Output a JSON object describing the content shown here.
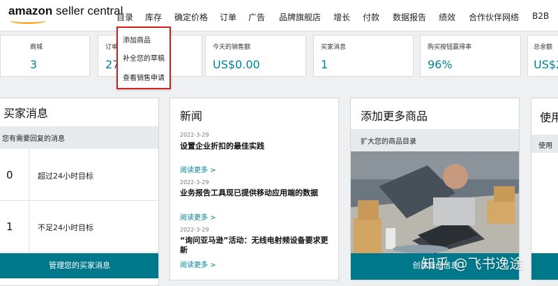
{
  "header": {
    "logo_brand": "amazon",
    "logo_product": " seller central",
    "nav": [
      "目录",
      "库存",
      "确定价格",
      "订单",
      "广告",
      "品牌旗舰店",
      "增长",
      "付款",
      "数据报告",
      "绩效",
      "合作伙伴网络",
      "B2B"
    ]
  },
  "catalog_menu": {
    "items": [
      "添加商品",
      "补全您的草稿",
      "查看销售申请"
    ]
  },
  "metrics": [
    {
      "label": "商城",
      "value": "3"
    },
    {
      "label": "订单",
      "value": "27"
    },
    {
      "label": "今天的销售额",
      "value": "US$0.00"
    },
    {
      "label": "买家消息",
      "value": "1"
    },
    {
      "label": "购买按钮赢得率",
      "value": "96%"
    },
    {
      "label": "总余额",
      "value": "US$2"
    }
  ],
  "buyer_messages": {
    "title": "买家消息",
    "subtitle": "您有需要回复的消息",
    "rows": [
      {
        "count": "0",
        "label": "超过24小时目标"
      },
      {
        "count": "1",
        "label": "不足24小时目标"
      }
    ],
    "button": "管理您的买家消息"
  },
  "news": {
    "title": "新闻",
    "items": [
      {
        "date": "2022-3-29",
        "title": "设置企业折扣的最佳实践",
        "link": "阅读更多 >"
      },
      {
        "date": "2022-3-29",
        "title": "业务报告工具现已提供移动应用端的数据",
        "link": "阅读更多 >"
      },
      {
        "date": "2022-3-29",
        "title": "“询问亚马逊”活动：无线电射频设备要求更新",
        "link": "阅读更多 >"
      }
    ]
  },
  "add_products": {
    "title": "添加更多商品",
    "subtitle": "扩大您的商品目录",
    "button": "创建商品信息"
  },
  "next_card": {
    "title": "使用",
    "subtitle": "使用"
  },
  "watermark": "知乎 @飞书逸途",
  "colors": {
    "teal": "#008296",
    "button": "#00788c",
    "highlight": "#d0201b",
    "orange": "#ff9900"
  }
}
